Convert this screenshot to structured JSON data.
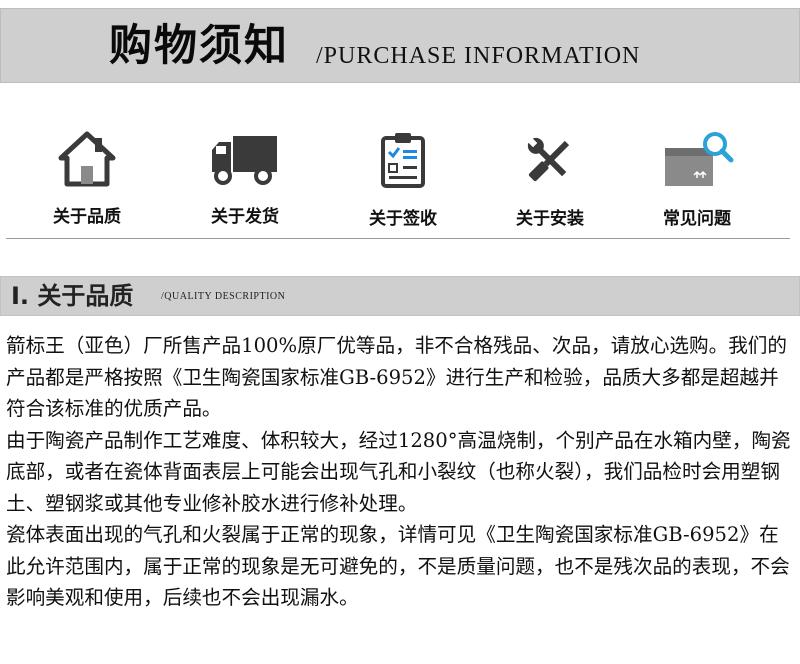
{
  "banner": {
    "title_cn": "购物须知",
    "title_en": "/PURCHASE INFORMATION"
  },
  "icons": [
    {
      "label": "关于品质",
      "icon": "house-icon"
    },
    {
      "label": "关于发货",
      "icon": "truck-icon"
    },
    {
      "label": "关于签收",
      "icon": "clipboard-checklist-icon"
    },
    {
      "label": "关于安装",
      "icon": "wrench-screwdriver-icon"
    },
    {
      "label": "常见问题",
      "icon": "box-magnifier-icon"
    }
  ],
  "section": {
    "title": "Ⅰ. 关于品质",
    "subtitle": "/QUALITY DESCRIPTION"
  },
  "paragraphs": [
    "箭标王（亚色）厂所售产品100%原厂优等品，非不合格残品、次品，请放心选购。我们的产品都是严格按照《卫生陶瓷国家标准GB-6952》进行生产和检验，品质大多都是超越并符合该标准的优质产品。",
    "由于陶瓷产品制作工艺难度、体积较大，经过1280°高温烧制，个别产品在水箱内壁，陶瓷底部，或者在瓷体背面表层上可能会出现气孔和小裂纹（也称火裂），我们品检时会用塑钢土、塑钢浆或其他专业修补胶水进行修补处理。",
    "瓷体表面出现的气孔和火裂属于正常的现象，详情可见《卫生陶瓷国家标准GB-6952》在此允许范围内，属于正常的现象是无可避免的，不是质量问题，也不是残次品的表现，不会影响美观和使用，后续也不会出现漏水。"
  ],
  "colors": {
    "bar_gray": "#cfcfcf",
    "icon_dark": "#3a3a3a",
    "icon_accent": "#2aa3d6",
    "check_blue": "#1e88e5"
  }
}
